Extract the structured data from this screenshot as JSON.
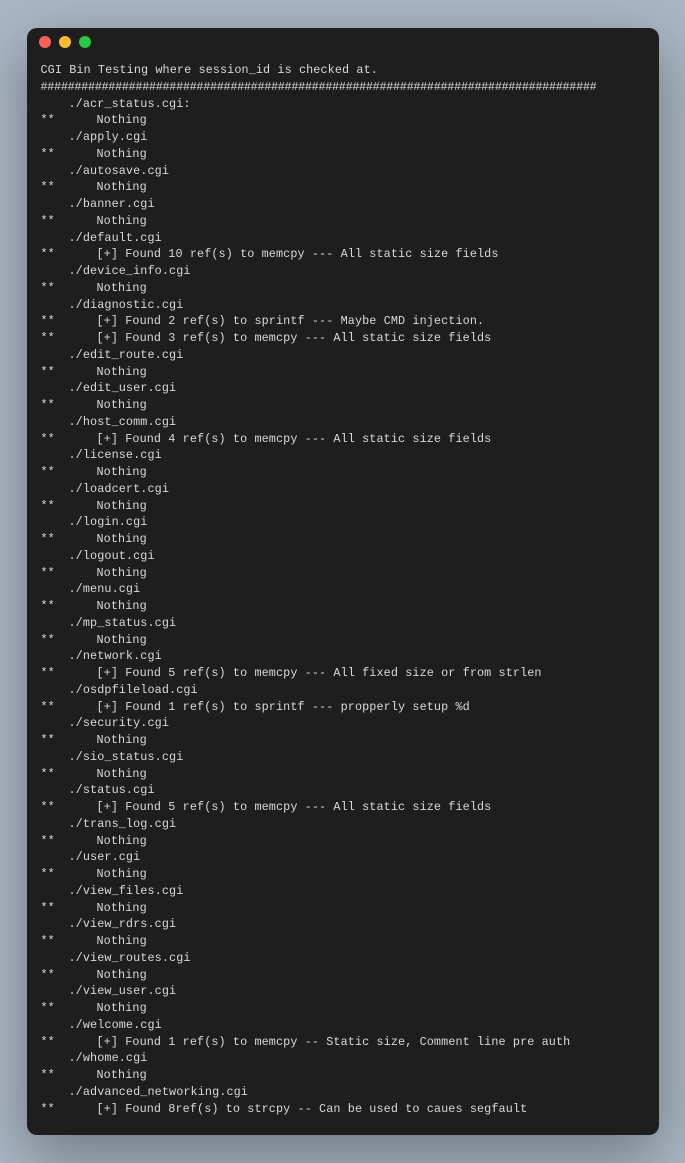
{
  "header": "CGI Bin Testing where session_id is checked at.",
  "separator": "##################################################################################",
  "star_prefix": "**",
  "entries": [
    {
      "file": "./acr_status.cgi:",
      "results": [
        "Nothing"
      ]
    },
    {
      "file": "./apply.cgi",
      "results": [
        "Nothing"
      ]
    },
    {
      "file": "./autosave.cgi",
      "results": [
        "Nothing"
      ]
    },
    {
      "file": "./banner.cgi",
      "results": [
        "Nothing"
      ]
    },
    {
      "file": "./default.cgi",
      "results": [
        "[+] Found 10 ref(s) to memcpy --- All static size fields"
      ]
    },
    {
      "file": "./device_info.cgi",
      "results": [
        "Nothing"
      ]
    },
    {
      "file": "./diagnostic.cgi",
      "results": [
        "[+] Found 2 ref(s) to sprintf --- Maybe CMD injection.",
        "[+] Found 3 ref(s) to memcpy --- All static size fields"
      ]
    },
    {
      "file": "./edit_route.cgi",
      "results": [
        "Nothing"
      ]
    },
    {
      "file": "./edit_user.cgi",
      "results": [
        "Nothing"
      ]
    },
    {
      "file": "./host_comm.cgi",
      "results": [
        "[+] Found 4 ref(s) to memcpy --- All static size fields"
      ]
    },
    {
      "file": "./license.cgi",
      "results": [
        "Nothing"
      ]
    },
    {
      "file": "./loadcert.cgi",
      "results": [
        "Nothing"
      ]
    },
    {
      "file": "./login.cgi",
      "results": [
        "Nothing"
      ]
    },
    {
      "file": "./logout.cgi",
      "results": [
        "Nothing"
      ]
    },
    {
      "file": "./menu.cgi",
      "results": [
        "Nothing"
      ]
    },
    {
      "file": "./mp_status.cgi",
      "results": [
        "Nothing"
      ]
    },
    {
      "file": "./network.cgi",
      "results": [
        "[+] Found 5 ref(s) to memcpy --- All fixed size or from strlen"
      ]
    },
    {
      "file": "./osdpfileload.cgi",
      "results": [
        "[+] Found 1 ref(s) to sprintf --- propperly setup %d"
      ]
    },
    {
      "file": "./security.cgi",
      "results": [
        "Nothing"
      ]
    },
    {
      "file": "./sio_status.cgi",
      "results": [
        "Nothing"
      ]
    },
    {
      "file": "./status.cgi",
      "results": [
        "[+] Found 5 ref(s) to memcpy --- All static size fields"
      ]
    },
    {
      "file": "./trans_log.cgi",
      "results": [
        "Nothing"
      ]
    },
    {
      "file": "./user.cgi",
      "results": [
        "Nothing"
      ]
    },
    {
      "file": "./view_files.cgi",
      "results": [
        "Nothing"
      ]
    },
    {
      "file": "./view_rdrs.cgi",
      "results": [
        "Nothing"
      ]
    },
    {
      "file": "./view_routes.cgi",
      "results": [
        "Nothing"
      ]
    },
    {
      "file": "./view_user.cgi",
      "results": [
        "Nothing"
      ]
    },
    {
      "file": "./welcome.cgi",
      "results": [
        "[+] Found 1 ref(s) to memcpy -- Static size, Comment line pre auth"
      ]
    },
    {
      "file": "./whome.cgi",
      "results": [
        "Nothing"
      ]
    },
    {
      "file": "./advanced_networking.cgi",
      "results": [
        "[+] Found 8ref(s) to strcpy -- Can be used to caues segfault"
      ]
    }
  ]
}
